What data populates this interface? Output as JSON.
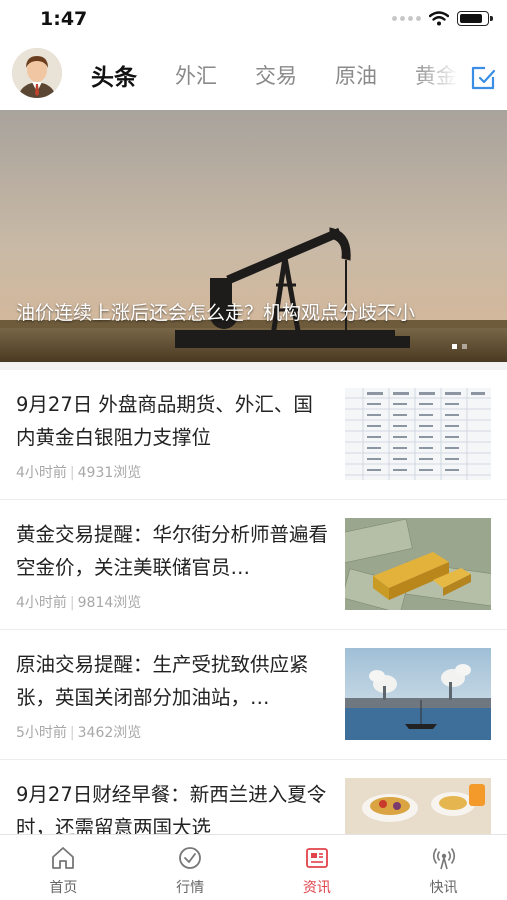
{
  "status_bar": {
    "time": "1:47",
    "battery_level": 0.85
  },
  "header": {
    "tabs": [
      "头条",
      "外汇",
      "交易",
      "原油",
      "黄金"
    ],
    "active_tab": "头条"
  },
  "banner": {
    "title": "油价连续上涨后还会怎么走？机构观点分歧不小",
    "slide_count": 2,
    "active_slide": 1
  },
  "news": [
    {
      "title": "9月27日 外盘商品期货、外汇、国内黄金白银阻力支撑位",
      "time": "4小时前",
      "views": "4931浏览",
      "thumb": "table-image"
    },
    {
      "title": "黄金交易提醒：华尔街分析师普遍看空金价，关注美联储官员…",
      "time": "4小时前",
      "views": "9814浏览",
      "thumb": "gold-bar-image"
    },
    {
      "title": "原油交易提醒：生产受扰致供应紧张，英国关闭部分加油站，…",
      "time": "5小时前",
      "views": "3462浏览",
      "thumb": "refinery-sea-image"
    },
    {
      "title": "9月27日财经早餐：新西兰进入夏令时，还需留意两国大选",
      "time": "",
      "views": "",
      "thumb": "breakfast-image"
    }
  ],
  "bottom_nav": [
    {
      "label": "首页",
      "icon": "home-icon"
    },
    {
      "label": "行情",
      "icon": "market-check-icon"
    },
    {
      "label": "资讯",
      "icon": "news-icon",
      "active": true
    },
    {
      "label": "快讯",
      "icon": "broadcast-icon"
    }
  ],
  "colors": {
    "accent": "#e1434a",
    "subscribe": "#3a8ee6"
  }
}
